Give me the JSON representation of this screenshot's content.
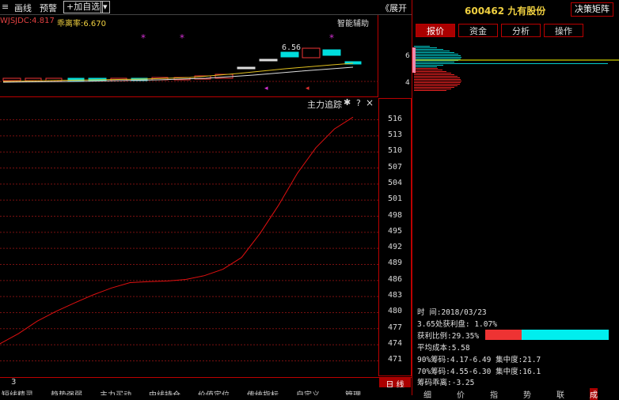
{
  "toolbar": {
    "draw_line": "画线",
    "alert": "预警",
    "add_favorite": "+加自选",
    "dropdown": "▾",
    "expand": "《展开"
  },
  "indicator_bar": {
    "left_label": "WJSJDC:4.817",
    "ratio_label": "乖离率:6.670",
    "smart_assist": "智能辅助",
    "price_marker": "6.56"
  },
  "main_chart": {
    "title": "主力追踪",
    "gear_icon": "gear-icon",
    "help_icon": "?",
    "close_icon": "×",
    "y_ticks": [
      516,
      513,
      510,
      507,
      504,
      501,
      498,
      495,
      492,
      489,
      486,
      483,
      480,
      477,
      474,
      471
    ],
    "bottom_left": "3",
    "period": "日 线"
  },
  "chart_data": {
    "type": "line",
    "ylim": [
      469,
      518
    ],
    "series": [
      {
        "values": [
          474.2,
          476.1,
          478.4,
          480.2,
          481.8,
          483.3,
          484.6,
          485.6,
          485.8,
          485.9,
          486.2,
          486.9,
          488.1,
          490.3,
          494.8,
          500.1,
          506.0,
          510.8,
          514.3,
          516.5
        ]
      }
    ],
    "line_color": "#e01010"
  },
  "top_chart": {
    "candles": [
      {
        "o": 0.6,
        "c": 0.55,
        "h": 0.65,
        "l": 0.5
      },
      {
        "o": 0.55,
        "c": 0.5,
        "h": 0.6,
        "l": 0.48
      },
      {
        "o": 0.52,
        "c": 0.48,
        "h": 0.55,
        "l": 0.45
      },
      {
        "o": 0.48,
        "c": 0.46,
        "h": 0.52,
        "l": 0.44
      },
      {
        "o": 0.46,
        "c": 0.45,
        "h": 0.5,
        "l": 0.42
      }
    ]
  },
  "right_panel": {
    "stock_code": "600462",
    "stock_name": "九有股份",
    "decision_button": "决策矩阵",
    "tabs": [
      "报价",
      "资金",
      "分析",
      "操作"
    ],
    "active_tab": "报价",
    "price_levels": [
      "6",
      "4"
    ],
    "info": {
      "time": "时      间:2018/03/23",
      "profit_line": "3.65处获利盘: 1.07%",
      "profit_ratio": "获利比例:29.35%",
      "avg_cost": "平均成本:5.58",
      "chip90": "90%筹码:4.17-6.49  集中度:21.7",
      "chip70": "70%筹码:4.55-6.30  集中度:16.1",
      "chip_ratio": "筹码乖离:-3.25"
    },
    "profit_ratio_value": 0.2935,
    "bottom_tabs": [
      "细",
      "价",
      "指",
      "势",
      "联",
      "成"
    ]
  },
  "bottom_tabs": [
    "短线精灵",
    "趋势强弱",
    "主力买动",
    "中线持仓",
    "价值定位",
    "传统指标",
    "自定义",
    "管理"
  ]
}
